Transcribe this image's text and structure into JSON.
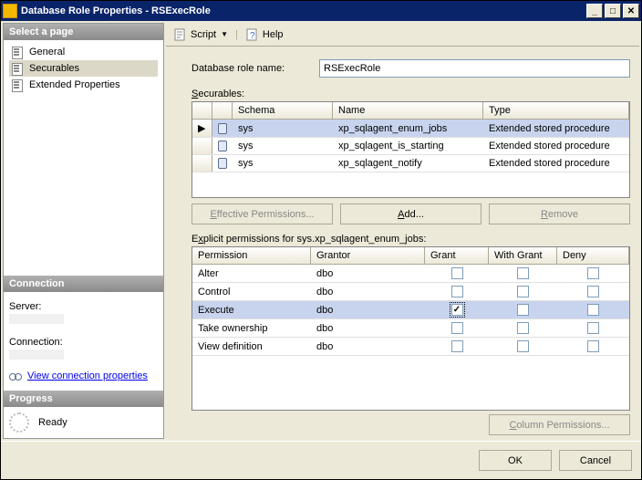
{
  "window": {
    "title": "Database Role Properties - RSExecRole"
  },
  "toolbar": {
    "script": "Script",
    "help": "Help"
  },
  "sidebar": {
    "selectPage": "Select a page",
    "items": [
      {
        "label": "General"
      },
      {
        "label": "Securables"
      },
      {
        "label": "Extended Properties"
      }
    ],
    "connection": {
      "header": "Connection",
      "serverLabel": "Server:",
      "connectionLabel": "Connection:",
      "viewProps": "View connection properties"
    },
    "progress": {
      "header": "Progress",
      "status": "Ready"
    }
  },
  "form": {
    "roleNameLabel": "Database role name:",
    "roleName": "RSExecRole",
    "securablesLabel": "Securables:",
    "explicitLabel": "Explicit permissions for sys.xp_sqlagent_enum_jobs:"
  },
  "securables": {
    "columns": {
      "schema": "Schema",
      "name": "Name",
      "type": "Type"
    },
    "rows": [
      {
        "schema": "sys",
        "name": "xp_sqlagent_enum_jobs",
        "type": "Extended stored procedure"
      },
      {
        "schema": "sys",
        "name": "xp_sqlagent_is_starting",
        "type": "Extended stored procedure"
      },
      {
        "schema": "sys",
        "name": "xp_sqlagent_notify",
        "type": "Extended stored procedure"
      }
    ]
  },
  "buttons": {
    "effective": "Effective Permissions...",
    "add": "Add...",
    "remove": "Remove",
    "columnPerms": "Column Permissions...",
    "ok": "OK",
    "cancel": "Cancel"
  },
  "permissions": {
    "columns": {
      "permission": "Permission",
      "grantor": "Grantor",
      "grant": "Grant",
      "withGrant": "With Grant",
      "deny": "Deny"
    },
    "rows": [
      {
        "permission": "Alter",
        "grantor": "dbo",
        "grant": false,
        "withGrant": false,
        "deny": false
      },
      {
        "permission": "Control",
        "grantor": "dbo",
        "grant": false,
        "withGrant": false,
        "deny": false
      },
      {
        "permission": "Execute",
        "grantor": "dbo",
        "grant": true,
        "withGrant": false,
        "deny": false
      },
      {
        "permission": "Take ownership",
        "grantor": "dbo",
        "grant": false,
        "withGrant": false,
        "deny": false
      },
      {
        "permission": "View definition",
        "grantor": "dbo",
        "grant": false,
        "withGrant": false,
        "deny": false
      }
    ]
  }
}
